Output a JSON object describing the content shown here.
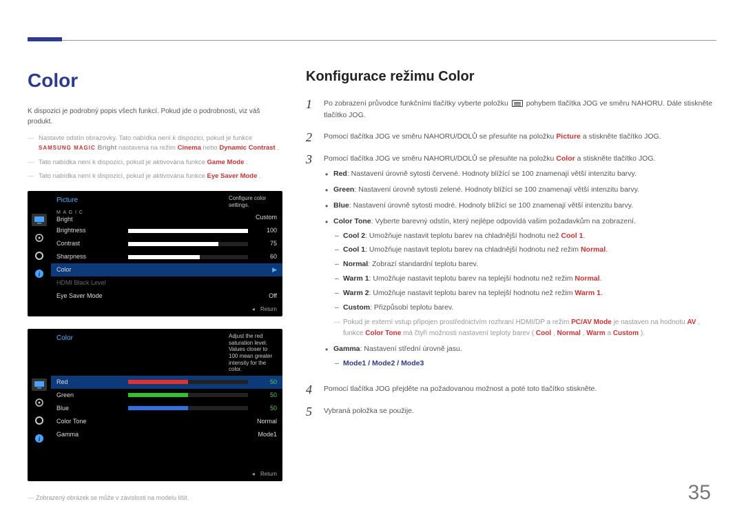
{
  "page_number": "35",
  "left": {
    "title": "Color",
    "intro": "K dispozici je podrobný popis všech funkcí. Pokud jde o podrobnosti, viz váš produkt.",
    "notes": {
      "n1_pre": "Nastavte odstín obrazovky. Tato nabídka není k dispozici, pokud je funkce ",
      "n1_brand": "SAMSUNG MAGIC",
      "n1_bright": "Bright",
      "n1_mid": " nastavena na režim ",
      "n1_cinema": "Cinema",
      "n1_or": " nebo ",
      "n1_dc": "Dynamic Contrast",
      "n2_pre": "Tato nabídka není k dispozici, pokud je aktivována funkce ",
      "n2_gm": "Game Mode",
      "n3_pre": "Tato nabídka není k dispozici, pokud je aktivována funkce ",
      "n3_es": "Eye Saver Mode",
      "dot": "."
    },
    "osd1": {
      "title": "Picture",
      "hint": "Configure color settings.",
      "rows": {
        "magic_brand": "SAMSUNG",
        "magic_line": "M A G I C",
        "magic_label": "Bright",
        "magic_val": "Custom",
        "brightness": "Brightness",
        "brightness_val": "100",
        "contrast": "Contrast",
        "contrast_val": "75",
        "sharpness": "Sharpness",
        "sharpness_val": "60",
        "color": "Color",
        "hdmi": "HDMI Black Level",
        "eyesaver": "Eye Saver Mode",
        "eyesaver_val": "Off"
      },
      "return": "Return"
    },
    "osd2": {
      "title": "Color",
      "hint": "Adjust the red saturation level. Values closer to 100 mean greater intensity for the color.",
      "rows": {
        "red": "Red",
        "red_val": "50",
        "green": "Green",
        "green_val": "50",
        "blue": "Blue",
        "blue_val": "50",
        "tone": "Color Tone",
        "tone_val": "Normal",
        "gamma": "Gamma",
        "gamma_val": "Mode1"
      },
      "return": "Return"
    },
    "footnote": "Zobrazený obrázek se může v závislosti na modelu lišit."
  },
  "right": {
    "title": "Konfigurace režimu Color",
    "step1a": "Po zobrazení průvodce funkčními tlačítky vyberte položku ",
    "step1b": " pohybem tlačítka JOG ve směru NAHORU. Dále stiskněte tlačítko JOG.",
    "step2a": "Pomocí tlačítka JOG ve směru NAHORU/DOLŮ se přesuňte na položku ",
    "step2_pic": "Picture",
    "step2b": " a stiskněte tlačítko JOG.",
    "step3a": "Pomocí tlačítka JOG ve směru NAHORU/DOLŮ se přesuňte na položku ",
    "step3_col": "Color",
    "step3b": " a stiskněte tlačítko JOG.",
    "b_red_lbl": "Red",
    "b_red_txt": ": Nastavení úrovně sytosti červené. Hodnoty blížící se 100 znamenají větší intenzitu barvy.",
    "b_green_lbl": "Green",
    "b_green_txt": ": Nastavení úrovně sytosti zelené. Hodnoty blížící se 100 znamenají větší intenzitu barvy.",
    "b_blue_lbl": "Blue",
    "b_blue_txt": ": Nastavení úrovně sytosti modré. Hodnoty blížící se 100 znamenají větší intenzitu barvy.",
    "b_tone_lbl": "Color Tone",
    "b_tone_txt": ": Vyberte barevný odstín, který nejlépe odpovídá vašim požadavkům na zobrazení.",
    "tone_cool2_lbl": "Cool 2",
    "tone_cool2_txt": ": Umožňuje nastavit teplotu barev na chladnější hodnotu než ",
    "tone_cool2_ref": "Cool 1",
    "tone_cool1_lbl": "Cool 1",
    "tone_cool1_txt": ": Umožňuje nastavit teplotu barev na chladnější hodnotu než režim ",
    "tone_cool1_ref": "Normal",
    "tone_normal_lbl": "Normal",
    "tone_normal_txt": ": Zobrazí standardní teplotu barev.",
    "tone_warm1_lbl": "Warm 1",
    "tone_warm1_txt": ": Umožňuje nastavit teplotu barev na teplejší hodnotu než režim ",
    "tone_warm1_ref": "Normal",
    "tone_warm2_lbl": "Warm 2",
    "tone_warm2_txt": ": Umožňuje nastavit teplotu barev na teplejší hodnotu než režim ",
    "tone_warm2_ref": "Warm 1",
    "tone_custom_lbl": "Custom",
    "tone_custom_txt": ": Přizpůsobí teplotu barev.",
    "note_a": "Pokud je externí vstup připojen prostřednictvím rozhraní HDMI/DP a režim ",
    "note_pcav": "PC/AV Mode",
    "note_b": " je nastaven na hodnotu ",
    "note_av": "AV",
    "note_c": ", funkce ",
    "note_ct": "Color Tone",
    "note_d": " má čtyři možnosti nastavení teploty barev (",
    "note_cool": "Cool",
    "note_sep1": ", ",
    "note_norm": "Normal",
    "note_sep2": ", ",
    "note_warm": "Warm",
    "note_sep3": " a ",
    "note_cust": "Custom",
    "note_end": ").",
    "b_gamma_lbl": "Gamma",
    "b_gamma_txt": ": Nastavení střední úrovně jasu.",
    "gamma_modes_m1": "Mode1",
    "gamma_modes_s1": " / ",
    "gamma_modes_m2": "Mode2",
    "gamma_modes_s2": " / ",
    "gamma_modes_m3": "Mode3",
    "step4": "Pomocí tlačítka JOG přejděte na požadovanou možnost a poté toto tlačítko stiskněte.",
    "step5": "Vybraná položka se použije."
  }
}
